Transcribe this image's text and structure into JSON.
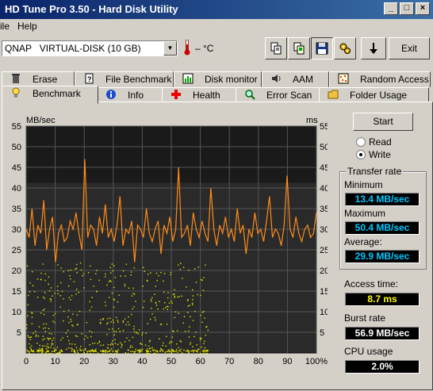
{
  "window": {
    "title": "HD Tune Pro 3.50 - Hard Disk Utility"
  },
  "menu": {
    "file": "ile",
    "help": "Help"
  },
  "toolbar": {
    "drive": "QNAP   VIRTUAL-DISK (10 GB)",
    "temperature": "– °C",
    "exit_label": "Exit"
  },
  "tabs_top": [
    {
      "label": "Erase",
      "icon": "trash-icon"
    },
    {
      "label": "File Benchmark",
      "icon": "document-icon"
    },
    {
      "label": "Disk monitor",
      "icon": "chart-icon"
    },
    {
      "label": "AAM",
      "icon": "speaker-icon"
    },
    {
      "label": "Random Access",
      "icon": "dots-icon"
    }
  ],
  "tabs_bottom": [
    {
      "label": "Benchmark",
      "icon": "lightbulb-icon"
    },
    {
      "label": "Info",
      "icon": "info-icon"
    },
    {
      "label": "Health",
      "icon": "health-cross-icon"
    },
    {
      "label": "Error Scan",
      "icon": "magnifier-icon"
    },
    {
      "label": "Folder Usage",
      "icon": "folder-icon"
    }
  ],
  "colors": {
    "line": "#ff8c1a",
    "dots": "#e6e600",
    "plot_bg": "#2a2a2a"
  },
  "chart_data": {
    "type": "line",
    "y_left_unit": "MB/sec",
    "y_right_unit": "ms",
    "x_ticks": [
      "0",
      "10",
      "20",
      "30",
      "40",
      "50",
      "60",
      "70",
      "80",
      "90",
      "100%"
    ],
    "y_ticks": [
      "5",
      "10",
      "15",
      "20",
      "25",
      "30",
      "35",
      "40",
      "45",
      "50",
      "55"
    ],
    "ylim": [
      0,
      55
    ],
    "xlim": [
      0,
      100
    ],
    "transfer_rate_series_mb_s": [
      30,
      28,
      35,
      26,
      31,
      29,
      37,
      25,
      30,
      33,
      22,
      29,
      31,
      27,
      28,
      32,
      30,
      34,
      29,
      25,
      47,
      28,
      31,
      30,
      26,
      33,
      29,
      36,
      28,
      30,
      27,
      31,
      38,
      26,
      30,
      29,
      32,
      22,
      31,
      30,
      28,
      35,
      29,
      27,
      30,
      32,
      24,
      31,
      29,
      33,
      27,
      30,
      45,
      28,
      29,
      31,
      26,
      34,
      30,
      28,
      32,
      29,
      27,
      40,
      30,
      26,
      31,
      29,
      33,
      28,
      30,
      27,
      35,
      29,
      31,
      24,
      30,
      28,
      34,
      29,
      30,
      27,
      32,
      38,
      28,
      30,
      29,
      26,
      31,
      43,
      30,
      28,
      33,
      29,
      27,
      30,
      31,
      28,
      29,
      34
    ],
    "access_time_note": "scattered points, mostly 0-20 ms, ending near 63%"
  },
  "controls": {
    "start_label": "Start",
    "read_label": "Read",
    "write_label": "Write",
    "selected_mode": "Write"
  },
  "transfer": {
    "group_title": "Transfer rate",
    "minimum_label": "Minimum",
    "minimum_value": "13.4 MB/sec",
    "maximum_label": "Maximum",
    "maximum_value": "50.4 MB/sec",
    "average_label": "Average:",
    "average_value": "29.9 MB/sec"
  },
  "stats": {
    "access_label": "Access time:",
    "access_value": "8.7 ms",
    "burst_label": "Burst rate",
    "burst_value": "56.9 MB/sec",
    "cpu_label": "CPU usage",
    "cpu_value": "2.0%"
  }
}
